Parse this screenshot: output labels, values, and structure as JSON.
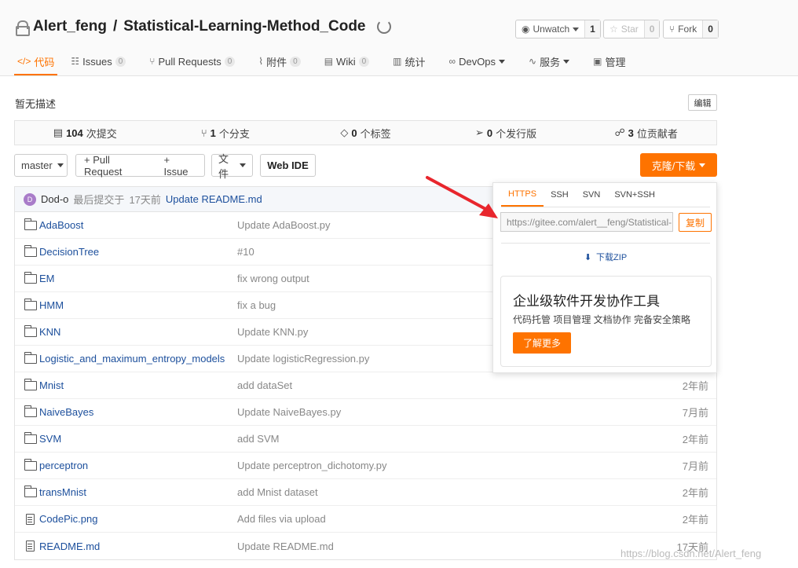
{
  "repo": {
    "owner": "Alert_feng",
    "separator": "/",
    "name": "Statistical-Learning-Method_Code"
  },
  "social": {
    "watch_label": "Unwatch",
    "watch_count": "1",
    "star_label": "Star",
    "star_count": "0",
    "fork_label": "Fork",
    "fork_count": "0"
  },
  "tabs": [
    {
      "label": "代码",
      "icon": "</>"
    },
    {
      "label": "Issues",
      "badge": "0"
    },
    {
      "label": "Pull Requests",
      "badge": "0"
    },
    {
      "label": "附件",
      "badge": "0"
    },
    {
      "label": "Wiki",
      "badge": "0"
    },
    {
      "label": "统计"
    },
    {
      "label": "DevOps"
    },
    {
      "label": "服务"
    },
    {
      "label": "管理"
    }
  ],
  "description": "暂无描述",
  "edit_label": "编辑",
  "stats": [
    {
      "num": "104",
      "label": "次提交"
    },
    {
      "num": "1",
      "label": "个分支"
    },
    {
      "num": "0",
      "label": "个标签"
    },
    {
      "num": "0",
      "label": "个发行版"
    },
    {
      "num": "3",
      "label": "位贡献者"
    }
  ],
  "toolbar": {
    "branch": "master",
    "pull_request": "+ Pull Request",
    "issue": "+ Issue",
    "file": "文件",
    "web_ide": "Web IDE",
    "clone": "克隆/下载"
  },
  "commit": {
    "avatar_letter": "D",
    "author": "Dod-o",
    "prefix": "最后提交于",
    "time": "17天前",
    "message": "Update README.md"
  },
  "files": [
    {
      "name": "AdaBoost",
      "type": "folder",
      "message": "Update AdaBoost.py",
      "time": ""
    },
    {
      "name": "DecisionTree",
      "type": "folder",
      "message": "#10",
      "time": ""
    },
    {
      "name": "EM",
      "type": "folder",
      "message": "fix wrong output",
      "time": ""
    },
    {
      "name": "HMM",
      "type": "folder",
      "message": "fix a bug",
      "time": ""
    },
    {
      "name": "KNN",
      "type": "folder",
      "message": "Update KNN.py",
      "time": ""
    },
    {
      "name": "Logistic_and_maximum_entropy_models",
      "type": "folder",
      "message": "Update logisticRegression.py",
      "time": ""
    },
    {
      "name": "Mnist",
      "type": "folder",
      "message": "add dataSet",
      "time": "2年前"
    },
    {
      "name": "NaiveBayes",
      "type": "folder",
      "message": "Update NaiveBayes.py",
      "time": "7月前"
    },
    {
      "name": "SVM",
      "type": "folder",
      "message": "add SVM",
      "time": "2年前"
    },
    {
      "name": "perceptron",
      "type": "folder",
      "message": "Update perceptron_dichotomy.py",
      "time": "7月前"
    },
    {
      "name": "transMnist",
      "type": "folder",
      "message": "add Mnist dataset",
      "time": "2年前"
    },
    {
      "name": "CodePic.png",
      "type": "file",
      "message": "Add files via upload",
      "time": "2年前"
    },
    {
      "name": "README.md",
      "type": "file",
      "message": "Update README.md",
      "time": "17天前"
    }
  ],
  "clone_popup": {
    "tabs": [
      "HTTPS",
      "SSH",
      "SVN",
      "SVN+SSH"
    ],
    "url": "https://gitee.com/alert__feng/Statistical-Learning-Method_Code.git",
    "copy": "复制",
    "zip": "下载ZIP",
    "promo_title": "企业级软件开发协作工具",
    "promo_sub": "代码托管 项目管理 文档协作 完备安全策略",
    "promo_btn": "了解更多"
  },
  "watermark": "https://blog.csdn.net/Alert_feng",
  "colors": {
    "accent": "#fe7300",
    "link": "#1c4f9c",
    "annotation_arrow": "#e8262d"
  }
}
